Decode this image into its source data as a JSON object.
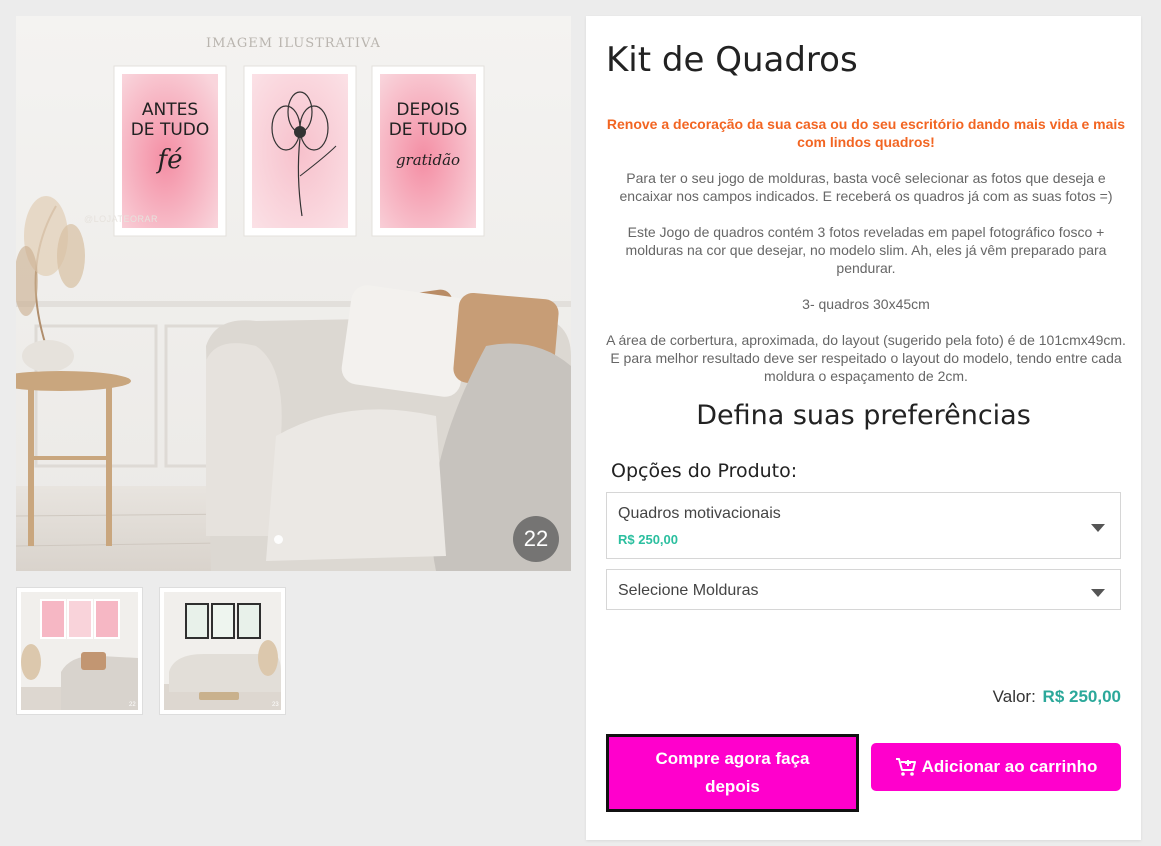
{
  "gallery": {
    "illustrative_label": "IMAGEM ILUSTRATIVA",
    "watermark": "@LOJATEORAR",
    "frames": [
      {
        "line1": "ANTES",
        "line2": "DE TUDO",
        "script": "fé"
      },
      {
        "line1": "",
        "line2": "",
        "script": ""
      },
      {
        "line1": "DEPOIS",
        "line2": "DE TUDO",
        "script": "gratidão"
      }
    ],
    "photo_count": "22",
    "thumbnails": [
      {
        "count": "22"
      },
      {
        "count": "23"
      }
    ]
  },
  "product": {
    "title": "Kit de Quadros",
    "highlight": "Renove a decoração da sua casa ou do seu escritório dando mais vida e mais com  lindos quadros!",
    "paragraphs": [
      "Para ter o seu jogo de molduras, basta você selecionar as fotos que deseja e encaixar nos campos indicados. E receberá os quadros já com as suas fotos =)",
      "Este Jogo de quadros contém 3 fotos reveladas em papel fotográfico fosco + molduras na cor que desejar, no modelo slim. Ah, eles já vêm preparado para pendurar.",
      "3- quadros 30x45cm",
      "A área de corbertura, aproximada, do layout (sugerido pela foto) é de 101cmx49cm. E para melhor resultado deve ser respeitado o layout do modelo, tendo entre cada moldura o espaçamento de 2cm."
    ],
    "preferences_title": "Defina suas preferências",
    "options_label": "Opções do Produto:",
    "select_product": {
      "value": "Quadros motivacionais",
      "price": "R$ 250,00"
    },
    "select_frames": {
      "value": "Selecione Molduras"
    },
    "valor_label": "Valor:",
    "valor_price": "R$ 250,00",
    "buy_later_label": "Compre agora faça depois",
    "add_cart_label": "Adicionar ao carrinho"
  },
  "colors": {
    "accent": "#ff00cc",
    "highlight": "#f26522",
    "price": "#2ba89a",
    "price_option": "#2bbf9f"
  },
  "icons": {
    "cart": "cart-plus-icon",
    "dropdown": "chevron-down-icon"
  }
}
